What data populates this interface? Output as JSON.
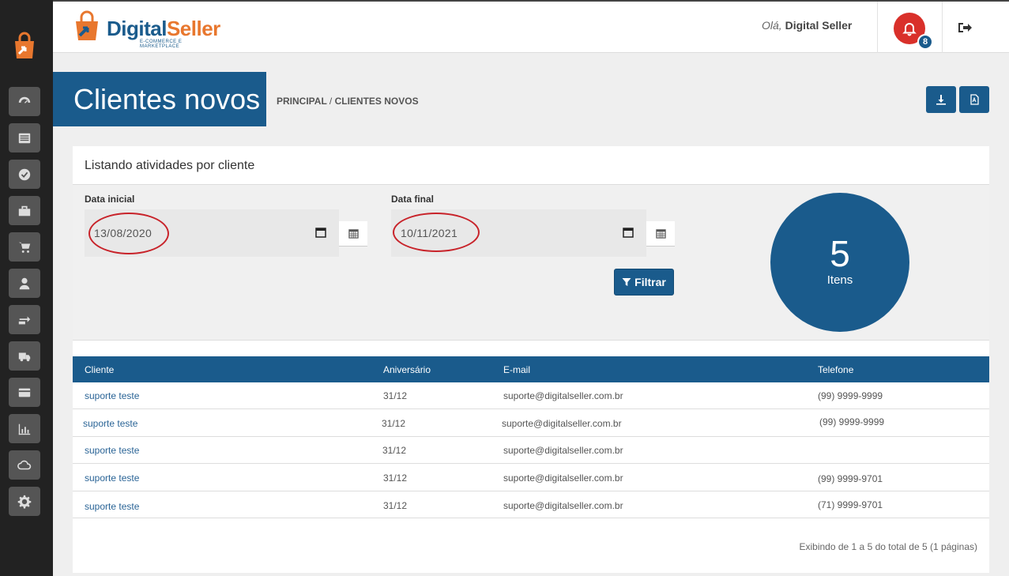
{
  "header": {
    "brand_name_a": "Digital",
    "brand_name_b": "Seller",
    "brand_tagline": "E-COMMERCE E MARKETPLACE",
    "greeting_prefix": "Olá,",
    "greeting_user": "Digital Seller",
    "notification_count": "8"
  },
  "sidebar": {
    "items": [
      {
        "icon": "dashboard-icon"
      },
      {
        "icon": "list-icon"
      },
      {
        "icon": "check-circle-icon"
      },
      {
        "icon": "briefcase-icon"
      },
      {
        "icon": "cart-icon"
      },
      {
        "icon": "user-icon"
      },
      {
        "icon": "exchange-icon"
      },
      {
        "icon": "truck-icon"
      },
      {
        "icon": "credit-card-icon"
      },
      {
        "icon": "bar-chart-icon"
      },
      {
        "icon": "cloud-icon"
      },
      {
        "icon": "gear-icon"
      }
    ]
  },
  "page": {
    "title": "Clientes novos",
    "breadcrumb_root": "PRINCIPAL",
    "breadcrumb_sep": "/",
    "breadcrumb_current": "CLIENTES NOVOS"
  },
  "panel": {
    "heading": "Listando atividades por cliente",
    "date_start_label": "Data inicial",
    "date_start_value": "13/08/2020",
    "date_end_label": "Data final",
    "date_end_value": "10/11/2021",
    "filter_button": "Filtrar",
    "count_value": "5",
    "count_label": "Itens"
  },
  "table": {
    "columns": [
      "Cliente",
      "Aniversário",
      "E-mail",
      "Telefone"
    ],
    "rows": [
      {
        "cliente": "suporte teste",
        "aniversario": "31/12",
        "email": "suporte@digitalseller.com.br",
        "telefone": "(99) 9999-9999"
      },
      {
        "cliente": "suporte teste",
        "aniversario": "31/12",
        "email": "suporte@digitalseller.com.br",
        "telefone": "(99) 9999-9999"
      },
      {
        "cliente": "suporte teste",
        "aniversario": "31/12",
        "email": "suporte@digitalseller.com.br",
        "telefone": ""
      },
      {
        "cliente": "suporte teste",
        "aniversario": "31/12",
        "email": "suporte@digitalseller.com.br",
        "telefone": "(99) 9999-9701"
      },
      {
        "cliente": "suporte teste",
        "aniversario": "31/12",
        "email": "suporte@digitalseller.com.br",
        "telefone": "(71) 9999-9701"
      }
    ],
    "pagination_info": "Exibindo de 1 a 5 do total de 5 (1 páginas)"
  },
  "colors": {
    "primary": "#1a5b8c",
    "accent": "#e8772e",
    "notification": "#d9302a",
    "annotation_circle": "#c8232a"
  }
}
